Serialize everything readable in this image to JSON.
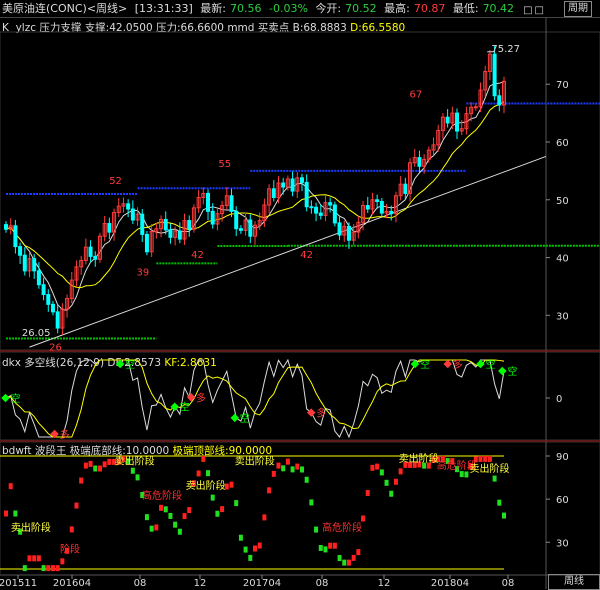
{
  "topbar": {
    "title": "美原油连(CONC)<周线>",
    "time": "[13:31:33]",
    "latest_label": "最新:",
    "latest": "70.56",
    "change": "-0.03%",
    "open_label": "今开:",
    "open": "70.52",
    "high_label": "最高:",
    "high": "70.87",
    "low_label": "最低:",
    "low": "70.42",
    "period_button": "周期",
    "icons": "□□"
  },
  "main_legend": {
    "k": "K",
    "name": "ylzc 压力支撑",
    "support": "支撑:42.0500",
    "pressure": "压力:66.6600",
    "mmd": "mmd 买卖点",
    "b": "B:68.8883",
    "d": "D:66.5580"
  },
  "dkx_legend": {
    "name": "dkx 多空线(26,12,9)",
    "df": "DF:2.8573",
    "kf": "KF:2.8631"
  },
  "bdwft_legend": {
    "name": "bdwft 波段王",
    "low": "极端底部线:10.0000",
    "high": "极端顶部线:90.0000"
  },
  "bottom_button": "周线",
  "colors": {
    "up": "#ff3b3b",
    "down": "#00ffff",
    "ma1": "#dcdcdc",
    "ma2": "#ffff00",
    "blue_level": "#1e3cff",
    "green_level": "#00c000",
    "trend": "#dcdcdc",
    "buy": "#ff3b3b",
    "sell": "#00ff00"
  },
  "chart_data": [
    {
      "type": "candlestick",
      "name": "main",
      "ylim": [
        24,
        78
      ],
      "yticks": [
        "70",
        "60",
        "50",
        "40",
        "30"
      ],
      "xticks": [
        "201511",
        "201604",
        "08",
        "12",
        "201704",
        "08",
        "12",
        "201804",
        "08"
      ],
      "x": [
        "2015-11",
        "2016-04",
        "2016-08",
        "2016-12",
        "2017-04",
        "2017-08",
        "2017-12",
        "2018-04"
      ],
      "annotations": [
        {
          "text": "26.05",
          "x": 0.04,
          "y": 26.05
        },
        {
          "text": "75.27",
          "x": 0.9,
          "y": 75.27
        },
        {
          "text": "52",
          "x": 0.2,
          "y": 52
        },
        {
          "text": "55",
          "x": 0.4,
          "y": 55
        },
        {
          "text": "67",
          "x": 0.75,
          "y": 67
        },
        {
          "text": "39",
          "x": 0.25,
          "y": 39
        },
        {
          "text": "42",
          "x": 0.35,
          "y": 42
        },
        {
          "text": "42",
          "x": 0.55,
          "y": 42
        },
        {
          "text": "26",
          "x": 0.09,
          "y": 26
        }
      ],
      "levels": [
        {
          "name": "pressure",
          "values": [
            51,
            52,
            55,
            66.66
          ]
        },
        {
          "name": "support",
          "values": [
            26,
            39,
            42,
            42.05
          ]
        }
      ],
      "closes": [
        44.9,
        45.5,
        41.9,
        40.4,
        37.7,
        39.8,
        37.7,
        35.3,
        33.6,
        31.9,
        30.6,
        27.8,
        31.1,
        32.9,
        36.1,
        38.4,
        39.5,
        41.8,
        40.2,
        39.7,
        43.7,
        45.9,
        44.4,
        47.8,
        48.9,
        49.3,
        48.4,
        46.5,
        47.5,
        44.0,
        41.0,
        44.5,
        45.0,
        46.6,
        44.8,
        43.5,
        44.6,
        43.2,
        46.4,
        44.9,
        48.6,
        50.4,
        51.1,
        48.0,
        45.8,
        47.6,
        49.0,
        50.7,
        48.0,
        45.0,
        44.7,
        46.5,
        43.7,
        45.6,
        46.4,
        49.1,
        51.9,
        50.4,
        52.9,
        52.2,
        53.6,
        51.5,
        53.8,
        53.0,
        48.8,
        48.7,
        47.7,
        47.3,
        49.5,
        49.1,
        46.0,
        43.9,
        45.4,
        43.0,
        44.4,
        46.1,
        49.0,
        48.4,
        50.0,
        49.7,
        47.7,
        48.0,
        47.6,
        50.7,
        52.7,
        51.1,
        56.4,
        57.3,
        55.8,
        57.0,
        58.6,
        59.5,
        62.0,
        64.3,
        63.3,
        65.0,
        61.9,
        62.3,
        64.9,
        66.0,
        66.1,
        69.0,
        72.2,
        75.2,
        68.0,
        66.4,
        70.5
      ],
      "highs_note": "approximate weekly OHLC reconstruction",
      "series": [
        {
          "name": "MA-short",
          "type": "line"
        },
        {
          "name": "MA-long",
          "type": "line"
        }
      ]
    },
    {
      "type": "line",
      "name": "dkx",
      "series": [
        {
          "name": "DF"
        },
        {
          "name": "KF"
        }
      ],
      "yticks": [
        "0"
      ],
      "signals": [
        {
          "text": "空",
          "x": 0.01
        },
        {
          "text": "多",
          "x": 0.1
        },
        {
          "text": "空",
          "x": 0.22
        },
        {
          "text": "空",
          "x": 0.32
        },
        {
          "text": "多",
          "x": 0.35
        },
        {
          "text": "空",
          "x": 0.43
        },
        {
          "text": "多",
          "x": 0.57
        },
        {
          "text": "空",
          "x": 0.76
        },
        {
          "text": "多",
          "x": 0.82
        },
        {
          "text": "空",
          "x": 0.88
        },
        {
          "text": "空",
          "x": 0.92
        }
      ]
    },
    {
      "type": "bar",
      "name": "bdwft",
      "yticks": [
        "90",
        "60",
        "30"
      ],
      "ylim": [
        10,
        90
      ],
      "labels": [
        {
          "text": "卖出阶段",
          "x": 0.02,
          "y": 38
        },
        {
          "text": "阶段",
          "x": 0.11,
          "y": 23
        },
        {
          "text": "卖出阶段",
          "x": 0.21,
          "y": 84
        },
        {
          "text": "高危阶段",
          "x": 0.26,
          "y": 60
        },
        {
          "text": "卖出阶段",
          "x": 0.34,
          "y": 67
        },
        {
          "text": "卖出阶段",
          "x": 0.43,
          "y": 84
        },
        {
          "text": "高危阶段",
          "x": 0.59,
          "y": 38
        },
        {
          "text": "卖出阶段",
          "x": 0.73,
          "y": 86
        },
        {
          "text": "高危阶段",
          "x": 0.8,
          "y": 81
        },
        {
          "text": "卖出阶段",
          "x": 0.86,
          "y": 79
        }
      ]
    }
  ]
}
